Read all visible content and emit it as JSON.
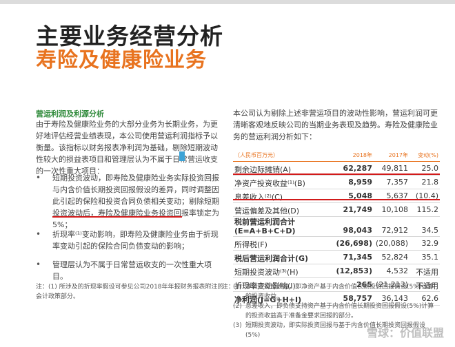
{
  "title": {
    "line1": "主要业务经营分析",
    "line2": "寿险及健康险业务"
  },
  "left": {
    "section_heading": "营运利润及利源分析",
    "intro": "由于寿险及健康险业务的大部分业务为长期业务，为更好地评估经营业绩表现，本公司使用营运利润指标予以衡量。该指标以财务报表净利润为基础，剔除短期波动性较大的损益表项目和管理层认为不属于日常营运收支的一次性重大项目：",
    "bullets": [
      {
        "dot": "•",
        "text": "短期投资波动，即寿险及健康险业务实际投资回报与内含价值长期投资回报假设的差异，同时调整因此引起的保险和投资合同负债相关变动；剔除短期投资波动后，寿险及健康险业务投资回报率锁定为5%；"
      },
      {
        "dot": "•",
        "text": "折现率⁽¹⁾变动影响，即寿险及健康险业务由于折现率变动引起的保险合同负债变动的影响；"
      },
      {
        "dot": "•",
        "text": "管理层认为不属于日常营运收支的一次性重大项目。"
      }
    ],
    "note": "注：(1) 所涉及的折现率假设可参见公司2018年年报财务报表附注的会计政策部分。"
  },
  "right": {
    "intro": "本公司认为剔除上述非营运项目的波动性影响，营运利润可更清晰客观地反映公司的当期业务表现及趋势。寿险及健康险业务的营运利润分析如下：",
    "table": {
      "headers": [
        "（人民币百万元）",
        "2018年",
        "2017年",
        "变动(%)"
      ],
      "rows": [
        {
          "label": "剩余边际摊销(A)",
          "y2018": "62,287",
          "y2017": "49,811",
          "chg": "25.0"
        },
        {
          "label": "净资产投资收益⁽¹⁾(B)",
          "y2018": "8,959",
          "y2017": "7,357",
          "chg": "21.8"
        },
        {
          "label": "息差收入⁽²⁾(C)",
          "y2018": "5,048",
          "y2017": "5,637",
          "chg": "(10.4)"
        },
        {
          "label": "营运偏差及其他(D)",
          "y2018": "21,749",
          "y2017": "10,108",
          "chg": "115.2"
        },
        {
          "label": "税前营运利润合计\n(E=A+B+C+D)",
          "y2018": "98,043",
          "y2017": "72,912",
          "chg": "34.5"
        },
        {
          "label": "所得税(F)",
          "y2018": "(26,698)",
          "y2017": "(20,088)",
          "chg": "32.9"
        },
        {
          "label": "税后营运利润合计(G)",
          "y2018": "71,345",
          "y2017": "52,824",
          "chg": "35.1"
        },
        {
          "label": "短期投资波动⁽³⁾(H)",
          "y2018": "(12,853)",
          "y2017": "4,532",
          "chg": "不适用"
        },
        {
          "label": "折现率变动影响(I)",
          "y2018": "265",
          "y2017": "(21,213)",
          "chg": "不适用"
        },
        {
          "label": "净利润(J=G+H+I)",
          "y2018": "58,757",
          "y2017": "36,143",
          "chg": "62.6"
        }
      ]
    },
    "notes": [
      {
        "label": "注：",
        "num": "(1)",
        "text": "净资产投资收益，即净资产基于内含价值长期投资回报假设(5%)计算的投资收益。"
      },
      {
        "label": "",
        "num": "(2)",
        "text": "息差收入，即负债支持资产基于内含价值长期投资回报假设(5%)计算的投资收益高于准备金要求回报的部分。"
      },
      {
        "label": "",
        "num": "(3)",
        "text": "短期投资波动，即实际投资回报与基于内含价值长期投资回报假设(5%)"
      }
    ]
  },
  "watermark": "雪球：价值联盟",
  "colors": {
    "accent": "#e8731f",
    "heading_green": "#2f8a3a",
    "underline_red": "#d11a1a"
  }
}
